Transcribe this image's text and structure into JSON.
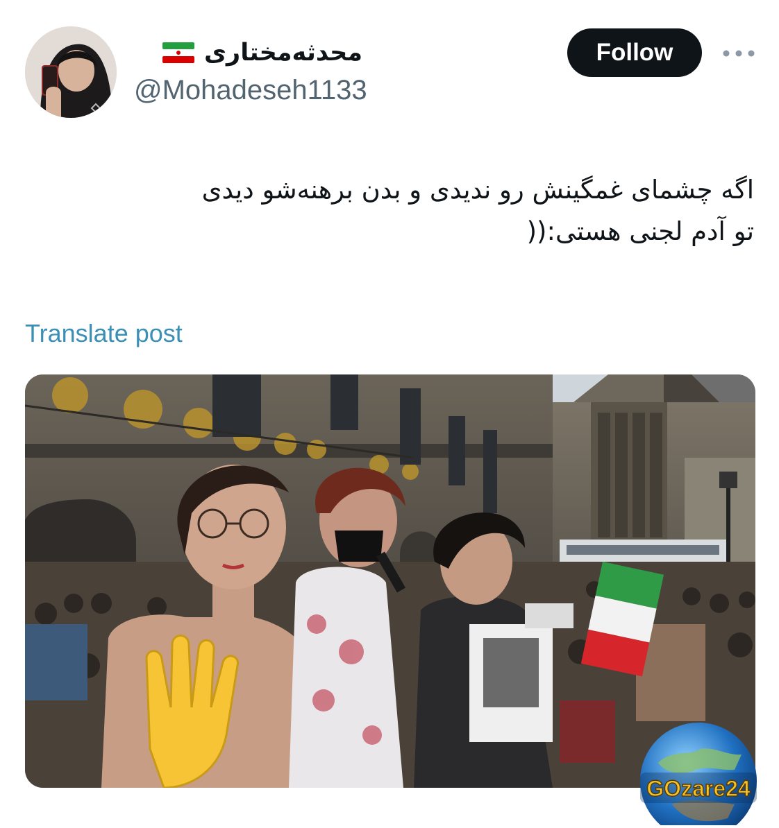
{
  "author": {
    "display_name": "محدثه‌مختاری",
    "handle": "@Mohadeseh1133",
    "flag_icon": "iran-flag-icon"
  },
  "actions": {
    "follow_label": "Follow",
    "more_icon": "more-horizontal-icon"
  },
  "post": {
    "text": "اگه چشمای غمگینش رو ندیدی و بدن برهنه‌شو دیدی\nتو آدم لجنی هستی:((",
    "translate_label": "Translate post"
  },
  "media": {
    "watermark_text": "GOzare24"
  },
  "colors": {
    "follow_bg": "#0f1419",
    "translate_link": "#3a8fb7",
    "handle": "#536471"
  }
}
